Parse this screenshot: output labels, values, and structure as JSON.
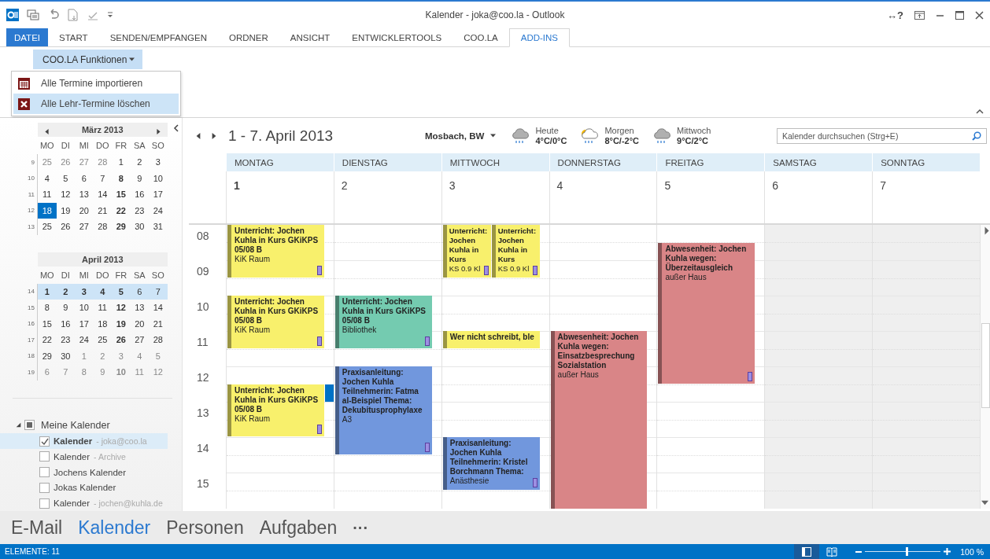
{
  "window": {
    "title": "Kalender - joka@coo.la - Outlook",
    "help": "↔?"
  },
  "ribbon": {
    "tabs": [
      {
        "label": "DATEI",
        "kind": "file",
        "selected": false
      },
      {
        "label": "START",
        "kind": "tab",
        "selected": false
      },
      {
        "label": "SENDEN/EMPFANGEN",
        "kind": "tab",
        "selected": false
      },
      {
        "label": "ORDNER",
        "kind": "tab",
        "selected": false
      },
      {
        "label": "ANSICHT",
        "kind": "tab",
        "selected": false
      },
      {
        "label": "ENTWICKLERTOOLS",
        "kind": "tab",
        "selected": false
      },
      {
        "label": "COO.LA",
        "kind": "tab",
        "selected": false
      },
      {
        "label": "ADD-INS",
        "kind": "tab",
        "selected": true
      }
    ],
    "menu_button": {
      "label": "COO.LA Funktionen",
      "expanded": true
    },
    "menu_items": [
      {
        "label": "Alle Termine importieren",
        "selected": false
      },
      {
        "label": "Alle Lehr-Termine löschen",
        "selected": true
      }
    ]
  },
  "mini_calendars": [
    {
      "title": "März 2013",
      "nav_arrows": true,
      "weekdays": [
        "MO",
        "DI",
        "MI",
        "DO",
        "FR",
        "SA",
        "SO"
      ],
      "weeks": [
        {
          "number": "9",
          "selected": false,
          "days": [
            {
              "n": "25",
              "bold": false,
              "other_month": true,
              "selected": false
            },
            {
              "n": "26",
              "bold": false,
              "other_month": true,
              "selected": false
            },
            {
              "n": "27",
              "bold": false,
              "other_month": true,
              "selected": false
            },
            {
              "n": "28",
              "bold": false,
              "other_month": true,
              "selected": false
            },
            {
              "n": "1",
              "bold": false,
              "other_month": false,
              "selected": false
            },
            {
              "n": "2",
              "bold": false,
              "other_month": false,
              "selected": false
            },
            {
              "n": "3",
              "bold": false,
              "other_month": false,
              "selected": false
            }
          ]
        },
        {
          "number": "10",
          "selected": false,
          "days": [
            {
              "n": "4",
              "bold": false,
              "other_month": false,
              "selected": false
            },
            {
              "n": "5",
              "bold": false,
              "other_month": false,
              "selected": false
            },
            {
              "n": "6",
              "bold": false,
              "other_month": false,
              "selected": false
            },
            {
              "n": "7",
              "bold": false,
              "other_month": false,
              "selected": false
            },
            {
              "n": "8",
              "bold": true,
              "other_month": false,
              "selected": false
            },
            {
              "n": "9",
              "bold": false,
              "other_month": false,
              "selected": false
            },
            {
              "n": "10",
              "bold": false,
              "other_month": false,
              "selected": false
            }
          ]
        },
        {
          "number": "11",
          "selected": false,
          "days": [
            {
              "n": "11",
              "bold": false,
              "other_month": false,
              "selected": false
            },
            {
              "n": "12",
              "bold": false,
              "other_month": false,
              "selected": false
            },
            {
              "n": "13",
              "bold": false,
              "other_month": false,
              "selected": false
            },
            {
              "n": "14",
              "bold": false,
              "other_month": false,
              "selected": false
            },
            {
              "n": "15",
              "bold": true,
              "other_month": false,
              "selected": false
            },
            {
              "n": "16",
              "bold": false,
              "other_month": false,
              "selected": false
            },
            {
              "n": "17",
              "bold": false,
              "other_month": false,
              "selected": false
            }
          ]
        },
        {
          "number": "12",
          "selected": false,
          "days": [
            {
              "n": "18",
              "bold": false,
              "other_month": false,
              "selected": true
            },
            {
              "n": "19",
              "bold": false,
              "other_month": false,
              "selected": false
            },
            {
              "n": "20",
              "bold": false,
              "other_month": false,
              "selected": false
            },
            {
              "n": "21",
              "bold": false,
              "other_month": false,
              "selected": false
            },
            {
              "n": "22",
              "bold": true,
              "other_month": false,
              "selected": false
            },
            {
              "n": "23",
              "bold": false,
              "other_month": false,
              "selected": false
            },
            {
              "n": "24",
              "bold": false,
              "other_month": false,
              "selected": false
            }
          ]
        },
        {
          "number": "13",
          "selected": false,
          "days": [
            {
              "n": "25",
              "bold": false,
              "other_month": false,
              "selected": false
            },
            {
              "n": "26",
              "bold": false,
              "other_month": false,
              "selected": false
            },
            {
              "n": "27",
              "bold": false,
              "other_month": false,
              "selected": false
            },
            {
              "n": "28",
              "bold": false,
              "other_month": false,
              "selected": false
            },
            {
              "n": "29",
              "bold": true,
              "other_month": false,
              "selected": false
            },
            {
              "n": "30",
              "bold": false,
              "other_month": false,
              "selected": false
            },
            {
              "n": "31",
              "bold": false,
              "other_month": false,
              "selected": false
            }
          ]
        }
      ]
    },
    {
      "title": "April 2013",
      "nav_arrows": false,
      "weekdays": [
        "MO",
        "DI",
        "MI",
        "DO",
        "FR",
        "SA",
        "SO"
      ],
      "weeks": [
        {
          "number": "14",
          "selected": true,
          "days": [
            {
              "n": "1",
              "bold": true,
              "other_month": false,
              "selected": false
            },
            {
              "n": "2",
              "bold": true,
              "other_month": false,
              "selected": false
            },
            {
              "n": "3",
              "bold": true,
              "other_month": false,
              "selected": false
            },
            {
              "n": "4",
              "bold": true,
              "other_month": false,
              "selected": false
            },
            {
              "n": "5",
              "bold": true,
              "other_month": false,
              "selected": false
            },
            {
              "n": "6",
              "bold": false,
              "other_month": false,
              "selected": false
            },
            {
              "n": "7",
              "bold": false,
              "other_month": false,
              "selected": false
            }
          ]
        },
        {
          "number": "15",
          "selected": false,
          "days": [
            {
              "n": "8",
              "bold": false,
              "other_month": false,
              "selected": false
            },
            {
              "n": "9",
              "bold": false,
              "other_month": false,
              "selected": false
            },
            {
              "n": "10",
              "bold": false,
              "other_month": false,
              "selected": false
            },
            {
              "n": "11",
              "bold": false,
              "other_month": false,
              "selected": false
            },
            {
              "n": "12",
              "bold": true,
              "other_month": false,
              "selected": false
            },
            {
              "n": "13",
              "bold": false,
              "other_month": false,
              "selected": false
            },
            {
              "n": "14",
              "bold": false,
              "other_month": false,
              "selected": false
            }
          ]
        },
        {
          "number": "16",
          "selected": false,
          "days": [
            {
              "n": "15",
              "bold": false,
              "other_month": false,
              "selected": false
            },
            {
              "n": "16",
              "bold": false,
              "other_month": false,
              "selected": false
            },
            {
              "n": "17",
              "bold": false,
              "other_month": false,
              "selected": false
            },
            {
              "n": "18",
              "bold": false,
              "other_month": false,
              "selected": false
            },
            {
              "n": "19",
              "bold": true,
              "other_month": false,
              "selected": false
            },
            {
              "n": "20",
              "bold": false,
              "other_month": false,
              "selected": false
            },
            {
              "n": "21",
              "bold": false,
              "other_month": false,
              "selected": false
            }
          ]
        },
        {
          "number": "17",
          "selected": false,
          "days": [
            {
              "n": "22",
              "bold": false,
              "other_month": false,
              "selected": false
            },
            {
              "n": "23",
              "bold": false,
              "other_month": false,
              "selected": false
            },
            {
              "n": "24",
              "bold": false,
              "other_month": false,
              "selected": false
            },
            {
              "n": "25",
              "bold": false,
              "other_month": false,
              "selected": false
            },
            {
              "n": "26",
              "bold": true,
              "other_month": false,
              "selected": false
            },
            {
              "n": "27",
              "bold": false,
              "other_month": false,
              "selected": false
            },
            {
              "n": "28",
              "bold": false,
              "other_month": false,
              "selected": false
            }
          ]
        },
        {
          "number": "18",
          "selected": false,
          "days": [
            {
              "n": "29",
              "bold": false,
              "other_month": false,
              "selected": false
            },
            {
              "n": "30",
              "bold": false,
              "other_month": false,
              "selected": false
            },
            {
              "n": "1",
              "bold": false,
              "other_month": true,
              "selected": false
            },
            {
              "n": "2",
              "bold": false,
              "other_month": true,
              "selected": false
            },
            {
              "n": "3",
              "bold": false,
              "other_month": true,
              "selected": false
            },
            {
              "n": "4",
              "bold": false,
              "other_month": true,
              "selected": false
            },
            {
              "n": "5",
              "bold": false,
              "other_month": true,
              "selected": false
            }
          ]
        },
        {
          "number": "19",
          "selected": false,
          "days": [
            {
              "n": "6",
              "bold": false,
              "other_month": true,
              "selected": false
            },
            {
              "n": "7",
              "bold": false,
              "other_month": true,
              "selected": false
            },
            {
              "n": "8",
              "bold": false,
              "other_month": true,
              "selected": false
            },
            {
              "n": "9",
              "bold": false,
              "other_month": true,
              "selected": false
            },
            {
              "n": "10",
              "bold": true,
              "other_month": true,
              "selected": false
            },
            {
              "n": "11",
              "bold": false,
              "other_month": true,
              "selected": false
            },
            {
              "n": "12",
              "bold": false,
              "other_month": true,
              "selected": false
            }
          ]
        }
      ]
    }
  ],
  "calendar_list": {
    "group": "Meine Kalender",
    "expanded": true,
    "partial": true,
    "items": [
      {
        "name": "Kalender",
        "account": "- joka@coo.la",
        "checked": true,
        "selected": true
      },
      {
        "name": "Kalender",
        "account": "- Archive",
        "checked": false,
        "selected": false
      },
      {
        "name": "Jochens Kalender",
        "checked": false,
        "selected": false
      },
      {
        "name": "Jokas Kalender",
        "checked": false,
        "selected": false
      },
      {
        "name": "Kalender",
        "account": "- jochen@kuhla.de",
        "checked": false,
        "selected": false
      }
    ]
  },
  "view": {
    "range": "1 - 7. April 2013",
    "location": "Mosbach, BW",
    "weather": [
      {
        "day": "Heute",
        "temp": "4°C/0°C"
      },
      {
        "day": "Morgen",
        "temp": "8°C/-2°C"
      },
      {
        "day": "Mittwoch",
        "temp": "9°C/2°C"
      }
    ],
    "search": {
      "placeholder": "Kalender durchsuchen (Strg+E)"
    }
  },
  "hours": [
    "08",
    "09",
    "10",
    "11",
    "12",
    "13",
    "14",
    "15"
  ],
  "days": [
    {
      "name": "MONTAG",
      "date": "1",
      "bold": true,
      "weekend": false,
      "events": [
        {
          "kind": "appointment",
          "title": "Unterricht: Jochen Kuhla in Kurs GKiKPS 05/08 B",
          "location": "KiK Raum",
          "color": "#f8f06c",
          "tag": true
        },
        {
          "kind": "appointment",
          "title": "Unterricht: Jochen Kuhla in Kurs GKiKPS 05/08 B",
          "location": "KiK Raum",
          "color": "#f8f06c",
          "tag": true
        },
        {
          "kind": "appointment",
          "title": "Unterricht: Jochen Kuhla in Kurs GKiKPS 05/08 B",
          "location": "KiK Raum",
          "color": "#f8f06c",
          "tag": true
        },
        {
          "kind": "marker",
          "color": "#0072c6"
        }
      ]
    },
    {
      "name": "DIENSTAG",
      "date": "2",
      "bold": false,
      "weekend": false,
      "events": [
        {
          "kind": "appointment",
          "title": "Unterricht: Jochen Kuhla in Kurs GKiKPS 05/08 B",
          "location": "Bibliothek",
          "color": "#74cbb0",
          "tag": true
        },
        {
          "kind": "appointment",
          "title": "Praxisanleitung: Jochen Kuhla Teilnehmerin: Fatma al-Beispiel Thema: Dekubitusprophylaxe",
          "location": "A3",
          "color": "#7197dd",
          "tag": true
        }
      ]
    },
    {
      "name": "MITTWOCH",
      "date": "3",
      "bold": false,
      "weekend": false,
      "events": [
        {
          "kind": "appointment",
          "title": "Unterricht: Jochen Kuhla in Kurs",
          "location": "KS 0.9 Kl",
          "color": "#f8f06c",
          "tag": true
        },
        {
          "kind": "appointment",
          "title": "Unterricht: Jochen Kuhla in Kurs",
          "location": "KS 0.9 Kl",
          "color": "#f8f06c",
          "tag": true
        },
        {
          "kind": "appointment",
          "title": "Wer nicht schreibt, ble",
          "color": "#f8f06c",
          "tag": false
        },
        {
          "kind": "appointment",
          "title": "Praxisanleitung: Jochen Kuhla Teilnehmerin: Kristel Borchmann Thema:",
          "location": "Anästhesie",
          "color": "#7197dd",
          "tag": true
        }
      ]
    },
    {
      "name": "DONNERSTAG",
      "date": "4",
      "bold": false,
      "weekend": false,
      "events": [
        {
          "kind": "appointment",
          "title": "Abwesenheit: Jochen Kuhla wegen: Einsatzbesprechung Sozialstation",
          "location": "außer Haus",
          "color": "#d98587",
          "tag": false
        }
      ]
    },
    {
      "name": "FREITAG",
      "date": "5",
      "bold": false,
      "weekend": false,
      "events": [
        {
          "kind": "appointment",
          "title": "Abwesenheit: Jochen Kuhla wegen: Überzeitausgleich",
          "location": "außer Haus",
          "color": "#d98587",
          "tag": true
        }
      ]
    },
    {
      "name": "SAMSTAG",
      "date": "6",
      "bold": false,
      "weekend": true
    },
    {
      "name": "SONNTAG",
      "date": "7",
      "bold": false,
      "weekend": true
    }
  ],
  "nav": {
    "items": [
      {
        "label": "E-Mail",
        "selected": false
      },
      {
        "label": "Kalender",
        "selected": true
      },
      {
        "label": "Personen",
        "selected": false
      },
      {
        "label": "Aufgaben",
        "selected": false
      }
    ],
    "more": "···"
  },
  "status_bar": {
    "items": "ELEMENTE: 11",
    "views": [
      {
        "kind": "normal",
        "selected": true
      },
      {
        "kind": "reading",
        "selected": false
      }
    ],
    "zoom": {
      "level": 0.55,
      "reading": "100 %"
    }
  }
}
